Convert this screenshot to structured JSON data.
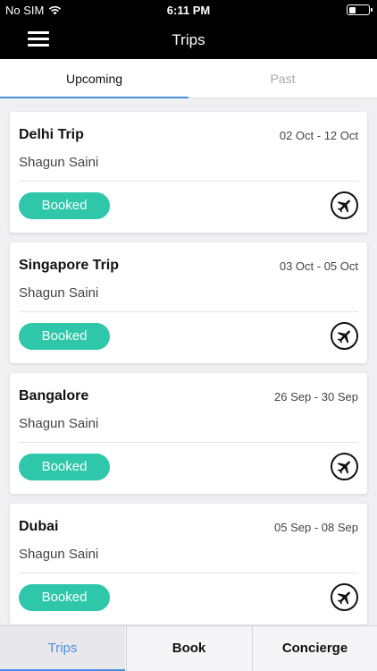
{
  "status_bar": {
    "carrier": "No SIM",
    "time": "6:11 PM",
    "icons": [
      "wifi-icon",
      "battery-icon"
    ]
  },
  "header": {
    "title": "Trips",
    "menu_icon": "hamburger-menu-icon"
  },
  "tabs": [
    {
      "label": "Upcoming",
      "active": true
    },
    {
      "label": "Past",
      "active": false
    }
  ],
  "trips": [
    {
      "name": "Delhi Trip",
      "dates": "02 Oct - 12 Oct",
      "traveler": "Shagun Saini",
      "status": "Booked",
      "icon": "airplane-icon"
    },
    {
      "name": "Singapore Trip",
      "dates": "03 Oct - 05 Oct",
      "traveler": "Shagun Saini",
      "status": "Booked",
      "icon": "airplane-icon"
    },
    {
      "name": "Bangalore",
      "dates": "26 Sep - 30 Sep",
      "traveler": "Shagun Saini",
      "status": "Booked",
      "icon": "airplane-icon"
    },
    {
      "name": "Dubai",
      "dates": "05 Sep - 08 Sep",
      "traveler": "Shagun Saini",
      "status": "Booked",
      "icon": "airplane-icon"
    }
  ],
  "bottom_tabs": [
    {
      "label": "Trips",
      "active": true
    },
    {
      "label": "Book",
      "active": false
    },
    {
      "label": "Concierge",
      "active": false
    }
  ],
  "colors": {
    "header_bg": "#000000",
    "accent_blue": "#4a90e2",
    "status_green": "#2ec7a9",
    "page_bg": "#f0f0f2"
  }
}
